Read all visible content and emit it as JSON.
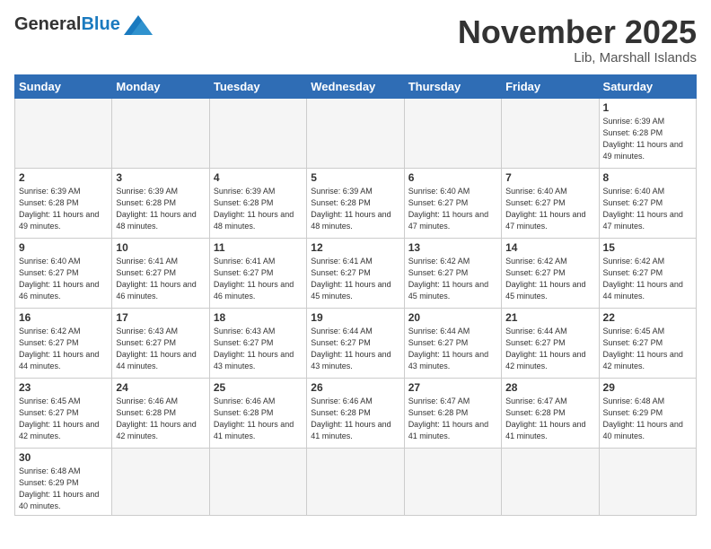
{
  "logo": {
    "general": "General",
    "blue": "Blue"
  },
  "title": "November 2025",
  "location": "Lib, Marshall Islands",
  "days": [
    "Sunday",
    "Monday",
    "Tuesday",
    "Wednesday",
    "Thursday",
    "Friday",
    "Saturday"
  ],
  "weeks": [
    [
      {
        "day": "",
        "info": ""
      },
      {
        "day": "",
        "info": ""
      },
      {
        "day": "",
        "info": ""
      },
      {
        "day": "",
        "info": ""
      },
      {
        "day": "",
        "info": ""
      },
      {
        "day": "",
        "info": ""
      },
      {
        "day": "1",
        "info": "Sunrise: 6:39 AM\nSunset: 6:28 PM\nDaylight: 11 hours and 49 minutes."
      }
    ],
    [
      {
        "day": "2",
        "info": "Sunrise: 6:39 AM\nSunset: 6:28 PM\nDaylight: 11 hours and 49 minutes."
      },
      {
        "day": "3",
        "info": "Sunrise: 6:39 AM\nSunset: 6:28 PM\nDaylight: 11 hours and 48 minutes."
      },
      {
        "day": "4",
        "info": "Sunrise: 6:39 AM\nSunset: 6:28 PM\nDaylight: 11 hours and 48 minutes."
      },
      {
        "day": "5",
        "info": "Sunrise: 6:39 AM\nSunset: 6:28 PM\nDaylight: 11 hours and 48 minutes."
      },
      {
        "day": "6",
        "info": "Sunrise: 6:40 AM\nSunset: 6:27 PM\nDaylight: 11 hours and 47 minutes."
      },
      {
        "day": "7",
        "info": "Sunrise: 6:40 AM\nSunset: 6:27 PM\nDaylight: 11 hours and 47 minutes."
      },
      {
        "day": "8",
        "info": "Sunrise: 6:40 AM\nSunset: 6:27 PM\nDaylight: 11 hours and 47 minutes."
      }
    ],
    [
      {
        "day": "9",
        "info": "Sunrise: 6:40 AM\nSunset: 6:27 PM\nDaylight: 11 hours and 46 minutes."
      },
      {
        "day": "10",
        "info": "Sunrise: 6:41 AM\nSunset: 6:27 PM\nDaylight: 11 hours and 46 minutes."
      },
      {
        "day": "11",
        "info": "Sunrise: 6:41 AM\nSunset: 6:27 PM\nDaylight: 11 hours and 46 minutes."
      },
      {
        "day": "12",
        "info": "Sunrise: 6:41 AM\nSunset: 6:27 PM\nDaylight: 11 hours and 45 minutes."
      },
      {
        "day": "13",
        "info": "Sunrise: 6:42 AM\nSunset: 6:27 PM\nDaylight: 11 hours and 45 minutes."
      },
      {
        "day": "14",
        "info": "Sunrise: 6:42 AM\nSunset: 6:27 PM\nDaylight: 11 hours and 45 minutes."
      },
      {
        "day": "15",
        "info": "Sunrise: 6:42 AM\nSunset: 6:27 PM\nDaylight: 11 hours and 44 minutes."
      }
    ],
    [
      {
        "day": "16",
        "info": "Sunrise: 6:42 AM\nSunset: 6:27 PM\nDaylight: 11 hours and 44 minutes."
      },
      {
        "day": "17",
        "info": "Sunrise: 6:43 AM\nSunset: 6:27 PM\nDaylight: 11 hours and 44 minutes."
      },
      {
        "day": "18",
        "info": "Sunrise: 6:43 AM\nSunset: 6:27 PM\nDaylight: 11 hours and 43 minutes."
      },
      {
        "day": "19",
        "info": "Sunrise: 6:44 AM\nSunset: 6:27 PM\nDaylight: 11 hours and 43 minutes."
      },
      {
        "day": "20",
        "info": "Sunrise: 6:44 AM\nSunset: 6:27 PM\nDaylight: 11 hours and 43 minutes."
      },
      {
        "day": "21",
        "info": "Sunrise: 6:44 AM\nSunset: 6:27 PM\nDaylight: 11 hours and 42 minutes."
      },
      {
        "day": "22",
        "info": "Sunrise: 6:45 AM\nSunset: 6:27 PM\nDaylight: 11 hours and 42 minutes."
      }
    ],
    [
      {
        "day": "23",
        "info": "Sunrise: 6:45 AM\nSunset: 6:27 PM\nDaylight: 11 hours and 42 minutes."
      },
      {
        "day": "24",
        "info": "Sunrise: 6:46 AM\nSunset: 6:28 PM\nDaylight: 11 hours and 42 minutes."
      },
      {
        "day": "25",
        "info": "Sunrise: 6:46 AM\nSunset: 6:28 PM\nDaylight: 11 hours and 41 minutes."
      },
      {
        "day": "26",
        "info": "Sunrise: 6:46 AM\nSunset: 6:28 PM\nDaylight: 11 hours and 41 minutes."
      },
      {
        "day": "27",
        "info": "Sunrise: 6:47 AM\nSunset: 6:28 PM\nDaylight: 11 hours and 41 minutes."
      },
      {
        "day": "28",
        "info": "Sunrise: 6:47 AM\nSunset: 6:28 PM\nDaylight: 11 hours and 41 minutes."
      },
      {
        "day": "29",
        "info": "Sunrise: 6:48 AM\nSunset: 6:29 PM\nDaylight: 11 hours and 40 minutes."
      }
    ],
    [
      {
        "day": "30",
        "info": "Sunrise: 6:48 AM\nSunset: 6:29 PM\nDaylight: 11 hours and 40 minutes."
      },
      {
        "day": "",
        "info": ""
      },
      {
        "day": "",
        "info": ""
      },
      {
        "day": "",
        "info": ""
      },
      {
        "day": "",
        "info": ""
      },
      {
        "day": "",
        "info": ""
      },
      {
        "day": "",
        "info": ""
      }
    ]
  ]
}
